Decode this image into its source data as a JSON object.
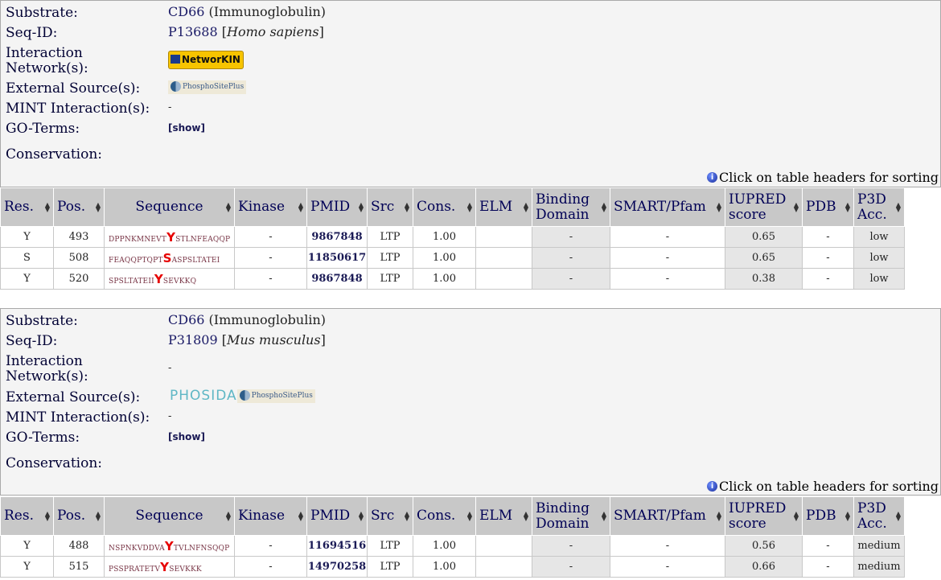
{
  "labels": {
    "substrate": "Substrate:",
    "seqid": "Seq-ID:",
    "interaction": "Interaction Network(s):",
    "external": "External Source(s):",
    "mint": "MINT Interaction(s):",
    "go": "GO-Terms:",
    "conservation": "Conservation:",
    "hint": "Click on table headers for sorting",
    "show": "[show]"
  },
  "headers": [
    "Res.",
    "Pos.",
    "Sequence",
    "Kinase",
    "PMID",
    "Src",
    "Cons.",
    "ELM",
    "Binding Domain",
    "SMART/Pfam",
    "IUPRED score",
    "PDB",
    "P3D Acc."
  ],
  "entries": [
    {
      "substrate": "CD66",
      "substrate_desc": "(Immunoglobulin)",
      "accession": "P13688",
      "organism": "Homo sapiens",
      "network_logo": "NetworKIN",
      "network_text": "",
      "source_logos": [
        "PhosphoSitePlus"
      ],
      "mint": "-",
      "rows": [
        {
          "res": "Y",
          "pos": "493",
          "seq_pre": "DPPNKMNEVT",
          "site": "Y",
          "seq_post": "STLNFEAQQP",
          "kinase": "-",
          "pmid": "9867848",
          "src": "LTP",
          "cons": "1.00",
          "elm": "",
          "bd": "-",
          "smart": "-",
          "iupred": "0.65",
          "pdb": "-",
          "p3d": "low"
        },
        {
          "res": "S",
          "pos": "508",
          "seq_pre": "FEAQQPTQPT",
          "site": "S",
          "seq_post": "ASPSLTATEI",
          "kinase": "-",
          "pmid": "11850617",
          "src": "LTP",
          "cons": "1.00",
          "elm": "",
          "bd": "-",
          "smart": "-",
          "iupred": "0.65",
          "pdb": "-",
          "p3d": "low"
        },
        {
          "res": "Y",
          "pos": "520",
          "seq_pre": "SPSLTATEII",
          "site": "Y",
          "seq_post": "SEVKKQ",
          "kinase": "-",
          "pmid": "9867848",
          "src": "LTP",
          "cons": "1.00",
          "elm": "",
          "bd": "-",
          "smart": "-",
          "iupred": "0.38",
          "pdb": "-",
          "p3d": "low"
        }
      ]
    },
    {
      "substrate": "CD66",
      "substrate_desc": "(Immunoglobulin)",
      "accession": "P31809",
      "organism": "Mus musculus",
      "network_logo": "",
      "network_text": "-",
      "source_logos": [
        "PHOSIDA",
        "PhosphoSitePlus"
      ],
      "mint": "-",
      "rows": [
        {
          "res": "Y",
          "pos": "488",
          "seq_pre": "NSPNKVDDVA",
          "site": "Y",
          "seq_post": "TVLNFNSQQP",
          "kinase": "-",
          "pmid": "11694516",
          "src": "LTP",
          "cons": "1.00",
          "elm": "",
          "bd": "-",
          "smart": "-",
          "iupred": "0.56",
          "pdb": "-",
          "p3d": "medium"
        },
        {
          "res": "Y",
          "pos": "515",
          "seq_pre": "PSSPRATETV",
          "site": "Y",
          "seq_post": "SEVKKK",
          "kinase": "-",
          "pmid": "14970258",
          "src": "LTP",
          "cons": "1.00",
          "elm": "",
          "bd": "-",
          "smart": "-",
          "iupred": "0.66",
          "pdb": "-",
          "p3d": "medium"
        }
      ]
    }
  ]
}
